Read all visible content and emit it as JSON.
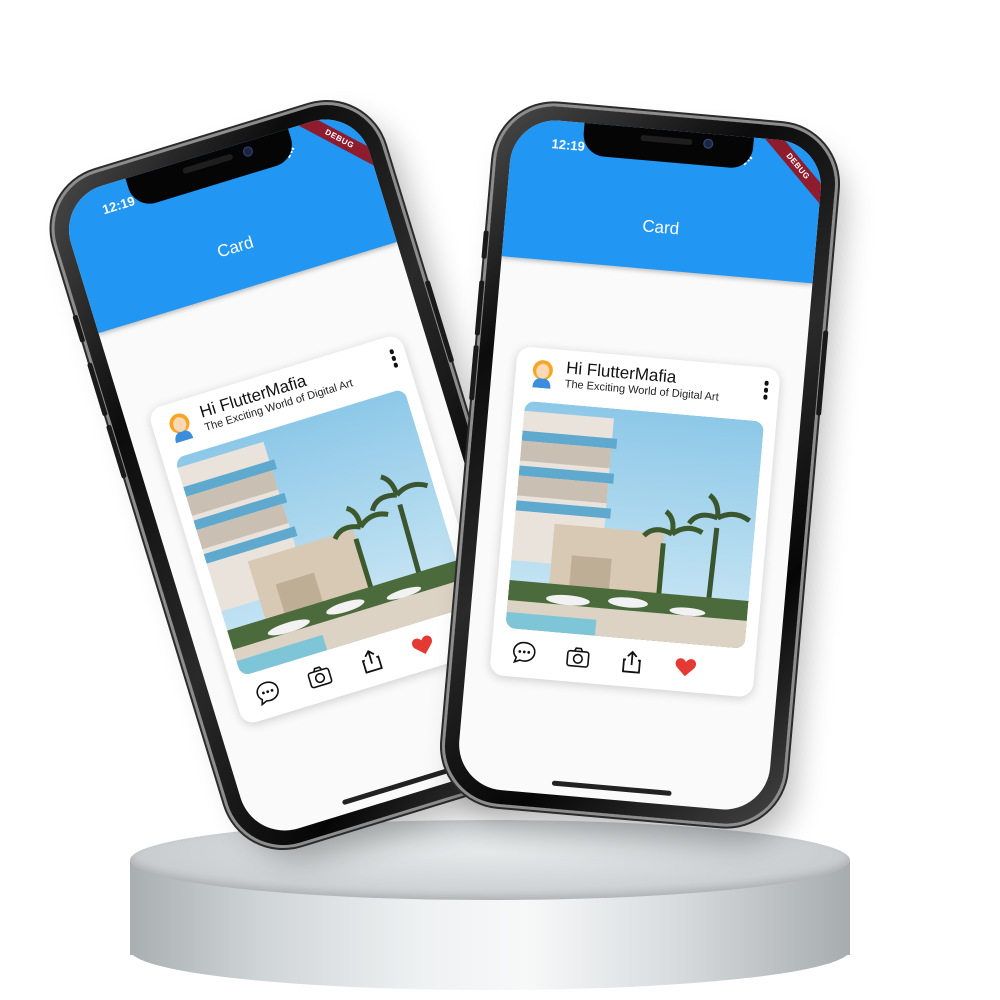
{
  "status": {
    "time": "12:19",
    "debug_badge": "DEBUG"
  },
  "appbar": {
    "title": "Card",
    "color": "#2196f3"
  },
  "card": {
    "title": "Hi FlutterMafia",
    "subtitle": "The Exciting World of Digital Art",
    "image_alt": "Resort hotel with palm trees and pool",
    "actions": [
      {
        "name": "comment-icon"
      },
      {
        "name": "camera-icon"
      },
      {
        "name": "share-icon"
      },
      {
        "name": "heart-icon",
        "color": "#e53935"
      }
    ]
  },
  "icons": {
    "wifi": "wifi-icon",
    "more": "more-vertical-icon",
    "avatar": "avatar-icon"
  }
}
